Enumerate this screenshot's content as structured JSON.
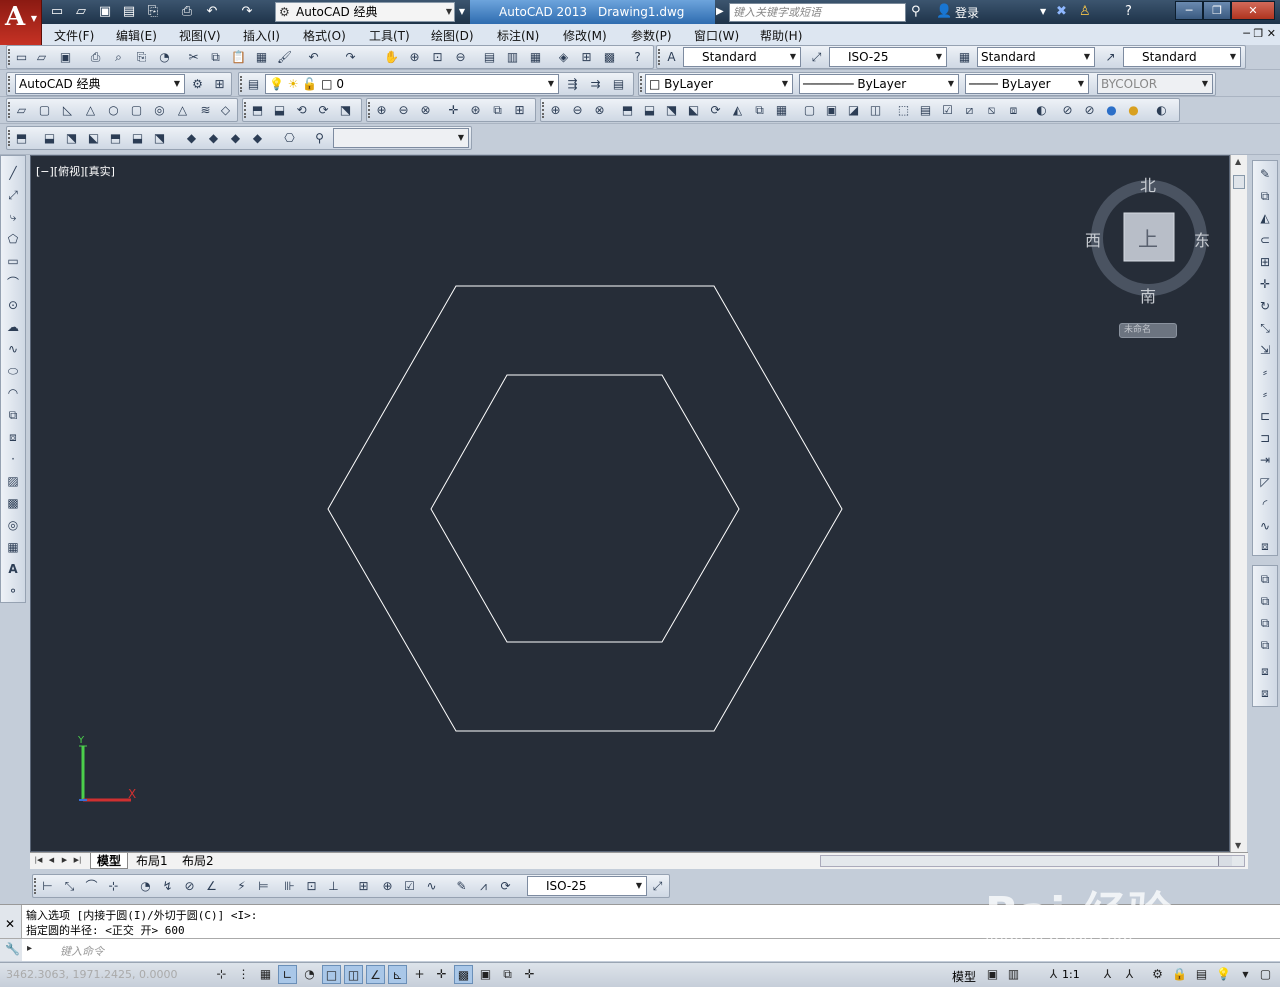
{
  "window": {
    "workspace_combo": "AutoCAD 经典",
    "app_name": "AutoCAD 2013",
    "doc_name": "Drawing1.dwg",
    "search_placeholder": "键入关键字或短语",
    "login_label": "登录"
  },
  "menu": [
    "文件(F)",
    "编辑(E)",
    "视图(V)",
    "插入(I)",
    "格式(O)",
    "工具(T)",
    "绘图(D)",
    "标注(N)",
    "修改(M)",
    "参数(P)",
    "窗口(W)",
    "帮助(H)"
  ],
  "styles": {
    "text_style": "Standard",
    "dim_style": "ISO-25",
    "table_style": "Standard",
    "mleader_style": "Standard"
  },
  "workspace_combo2": "AutoCAD 经典",
  "layer": {
    "current": "0"
  },
  "properties": {
    "color": "ByLayer",
    "linetype": "ByLayer",
    "lineweight": "ByLayer",
    "plotstyle": "BYCOLOR"
  },
  "viewport": {
    "label": "[−][俯视][真实]"
  },
  "viewcube": {
    "north": "北",
    "south": "南",
    "east": "东",
    "west": "西",
    "face": "上",
    "wcs_label": "未命名"
  },
  "ucs": {
    "x": "X",
    "y": "Y"
  },
  "layout_tabs": [
    "模型",
    "布局1",
    "布局2"
  ],
  "dim_toolbar": {
    "dim_style": "ISO-25"
  },
  "command": {
    "history": [
      "输入选项 [内接于圆(I)/外切于圆(C)] <I>:",
      "指定圆的半径: <正交 开> 600"
    ],
    "input_placeholder": "键入命令"
  },
  "status": {
    "coords": "3462.3063, 1971.2425, 0.0000",
    "model_label": "模型",
    "annotation_scale": "1:1"
  },
  "watermark": {
    "text": "Bai 经验",
    "url": "jingyan.baidu.com"
  }
}
